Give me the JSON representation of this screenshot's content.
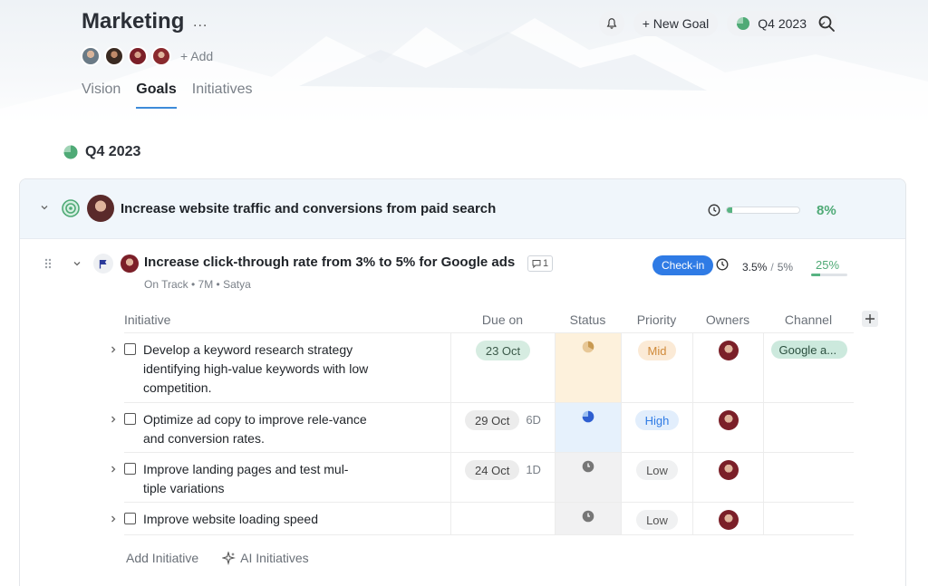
{
  "header": {
    "title": "Marketing",
    "more_label": "...",
    "add_member_label": "+ Add",
    "tabs": [
      {
        "label": "Vision",
        "active": false
      },
      {
        "label": "Goals",
        "active": true
      },
      {
        "label": "Initiatives",
        "active": false
      }
    ],
    "new_goal_label": "+ New Goal",
    "period_label": "Q4 2023"
  },
  "section": {
    "quarter": "Q4 2023"
  },
  "goal": {
    "title": "Increase website traffic and conversions from paid search",
    "progress_percent": 8,
    "progress_label": "8%"
  },
  "key_result": {
    "title": "Increase click-through rate from 3% to 5% for Google ads",
    "comment_count": "1",
    "meta": "On Track  •  7M  •  Satya",
    "checkin_label": "Check-in",
    "current_value": "3.5%",
    "separator": "/",
    "target_value": "5%",
    "progress_percent": 25,
    "progress_label": "25%"
  },
  "table": {
    "headers": {
      "initiative": "Initiative",
      "due_on": "Due on",
      "status": "Status",
      "priority": "Priority",
      "owners": "Owners",
      "channel": "Channel"
    },
    "rows": [
      {
        "text": "Develop a keyword research strategy identifying high-value keywords with low competition.",
        "due": "23 Oct",
        "remaining": "",
        "priority": "Mid",
        "channel": "Google a..."
      },
      {
        "text": "Optimize ad copy to improve rele-vance and conversion rates.",
        "due": "29 Oct",
        "remaining": "6D",
        "priority": "High",
        "channel": ""
      },
      {
        "text": "Improve landing pages and test mul-tiple variations",
        "due": "24 Oct",
        "remaining": "1D",
        "priority": "Low",
        "channel": ""
      },
      {
        "text": "Improve website loading speed",
        "due": "",
        "remaining": "",
        "priority": "Low",
        "channel": ""
      }
    ]
  },
  "footer": {
    "add_initiative_label": "Add Initiative",
    "ai_initiatives_label": "AI Initiatives"
  },
  "colors": {
    "accent_blue": "#2f7be5",
    "success_green": "#4faa76",
    "mid_orange": "#d08a3a",
    "status_mid_bg": "#fdf1dc",
    "status_high_bg": "#e6f1fc",
    "status_low_bg": "#f1f1f2"
  },
  "icons": {
    "more": "more-dots-icon",
    "bell": "bell-icon",
    "quarter": "pie-progress-icon",
    "search": "search-icon",
    "target": "target-icon",
    "flag": "flag-icon",
    "comment": "comment-icon",
    "clock": "clock-icon",
    "drag": "drag-handle-icon",
    "sparkle": "sparkle-icon",
    "plus": "plus-icon"
  }
}
